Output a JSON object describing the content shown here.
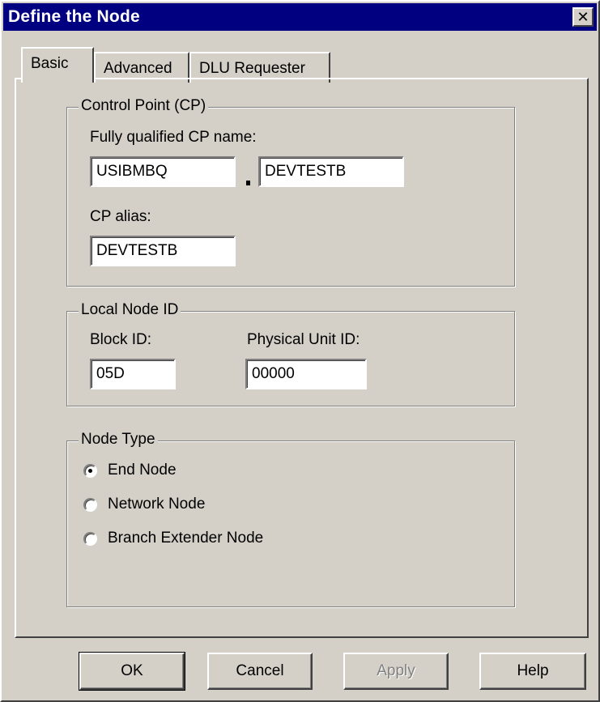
{
  "window": {
    "title": "Define the Node",
    "close_glyph": "✕"
  },
  "tabs": [
    {
      "label": "Basic",
      "active": true
    },
    {
      "label": "Advanced",
      "active": false
    },
    {
      "label": "DLU Requester",
      "active": false
    }
  ],
  "control_point": {
    "legend": "Control Point (CP)",
    "fq_label": "Fully qualified CP name:",
    "network_value": "USIBMBQ",
    "cp_value": "DEVTESTB",
    "alias_label": "CP alias:",
    "alias_value": "DEVTESTB"
  },
  "local_node_id": {
    "legend": "Local Node ID",
    "block_label": "Block ID:",
    "block_value": "05D",
    "pu_label": "Physical Unit ID:",
    "pu_value": "00000"
  },
  "node_type": {
    "legend": "Node Type",
    "options": [
      {
        "label": "End Node",
        "selected": true
      },
      {
        "label": "Network Node",
        "selected": false
      },
      {
        "label": "Branch Extender Node",
        "selected": false
      }
    ]
  },
  "buttons": {
    "ok": "OK",
    "cancel": "Cancel",
    "apply": "Apply",
    "help": "Help"
  },
  "colors": {
    "titlebar": "#000080",
    "face": "#d4d0c8"
  },
  "icons": {
    "close": "close-icon",
    "radio": "radio-button"
  }
}
